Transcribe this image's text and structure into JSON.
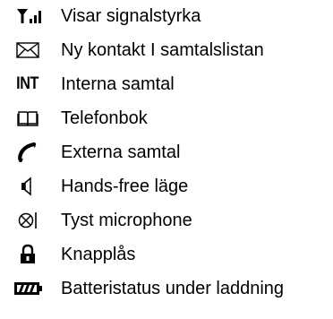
{
  "legend": {
    "items": [
      {
        "icon": "signal-strength-icon",
        "label": "Visar signalstyrka"
      },
      {
        "icon": "envelope-icon",
        "label": "Ny kontakt I samtalslistan"
      },
      {
        "icon": "int-icon",
        "icon_text": "INT",
        "label": "Interna samtal"
      },
      {
        "icon": "open-book-icon",
        "label": "Telefonbok"
      },
      {
        "icon": "handset-icon",
        "label": "Externa samtal"
      },
      {
        "icon": "speaker-icon",
        "label": "Hands-free läge"
      },
      {
        "icon": "mute-microphone-icon",
        "label": "Tyst microphone"
      },
      {
        "icon": "padlock-icon",
        "label": "Knapplås"
      },
      {
        "icon": "battery-charging-icon",
        "label": "Batteristatus under laddning"
      }
    ]
  }
}
